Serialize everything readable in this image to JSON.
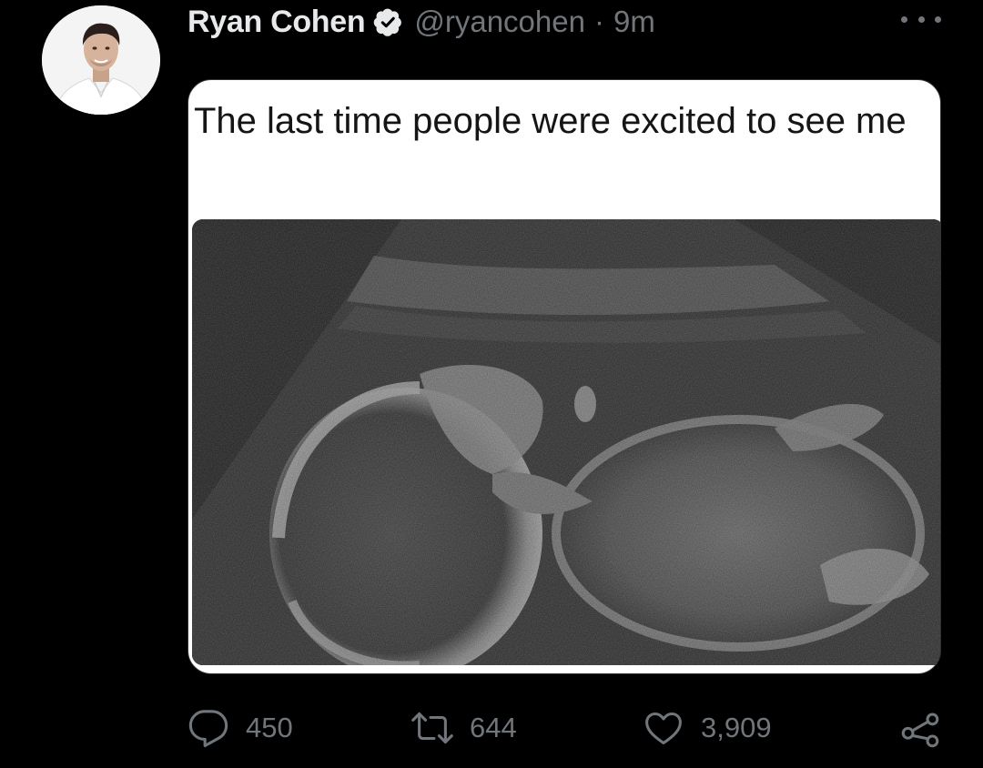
{
  "tweet": {
    "author": {
      "display_name": "Ryan Cohen",
      "handle": "@ryancohen",
      "verified": true
    },
    "separator": "·",
    "time": "9m",
    "media": {
      "caption": "The last time people were excited to see me"
    },
    "actions": {
      "replies": "450",
      "retweets": "644",
      "likes": "3,909"
    }
  },
  "colors": {
    "background": "#000000",
    "primary_text": "#e7e9ea",
    "secondary_text": "#71767b"
  },
  "icons": [
    "verified-badge-icon",
    "more-icon",
    "reply-icon",
    "retweet-icon",
    "like-icon",
    "share-icon"
  ]
}
